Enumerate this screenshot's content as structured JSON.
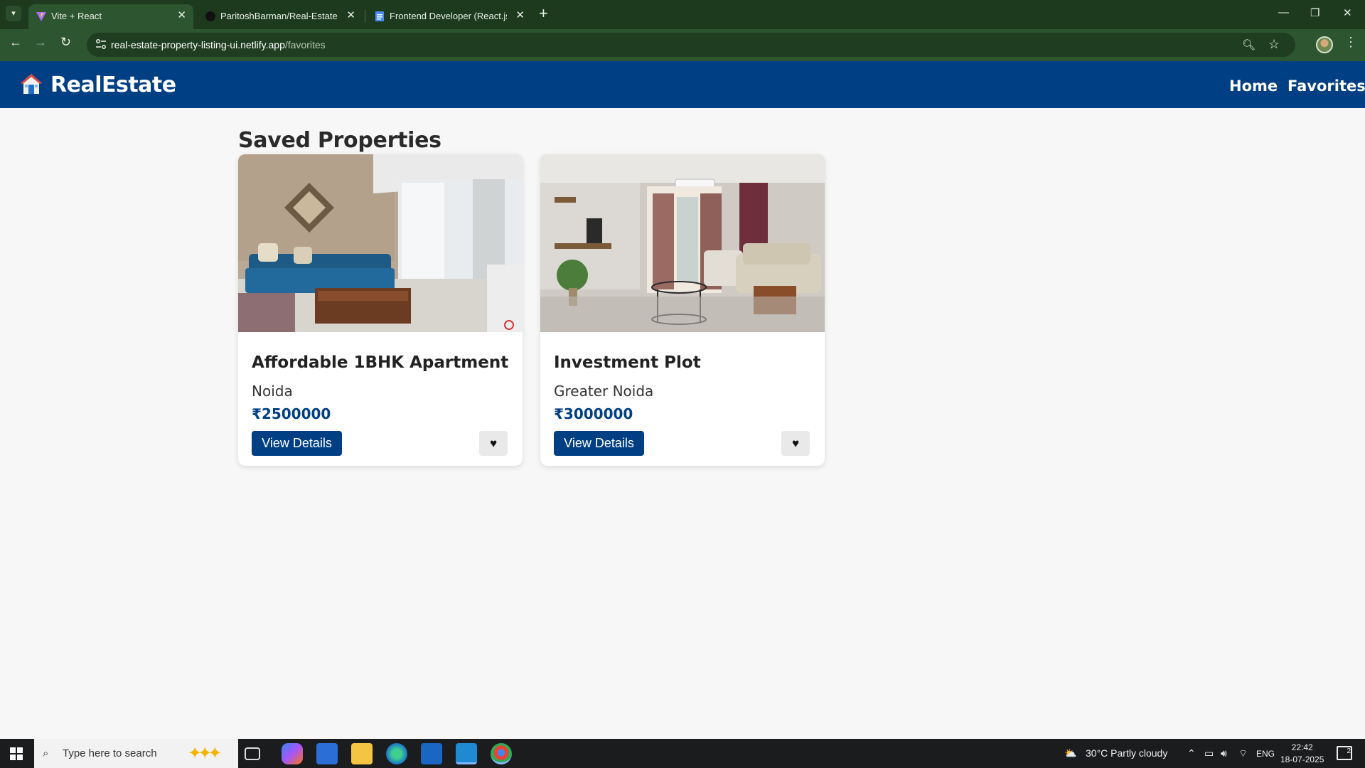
{
  "browser": {
    "tabs": [
      {
        "title": "Vite + React",
        "active": true
      },
      {
        "title": "ParitoshBarman/Real-Estate-Pr",
        "active": false
      },
      {
        "title": "Frontend Developer (React.js) In",
        "active": false
      }
    ],
    "url_domain": "real-estate-property-listing-ui.netlify.app",
    "url_path": "/favorites"
  },
  "site": {
    "brand": "RealEstate",
    "nav": {
      "home": "Home",
      "favorites": "Favorites"
    },
    "colors": {
      "primary": "#013f84",
      "background": "#f7f7f7"
    }
  },
  "page": {
    "title": "Saved Properties"
  },
  "properties": [
    {
      "title": "Affordable 1BHK Apartment",
      "location": "Noida",
      "price": "₹2500000",
      "details_label": "View Details",
      "fav_icon": "♥"
    },
    {
      "title": "Investment Plot",
      "location": "Greater Noida",
      "price": "₹3000000",
      "details_label": "View Details",
      "fav_icon": "♥"
    }
  ],
  "taskbar": {
    "search_placeholder": "Type here to search",
    "weather": "30°C  Partly cloudy",
    "lang": "ENG",
    "time": "22:42",
    "date": "18-07-2025",
    "notifications": "2"
  }
}
